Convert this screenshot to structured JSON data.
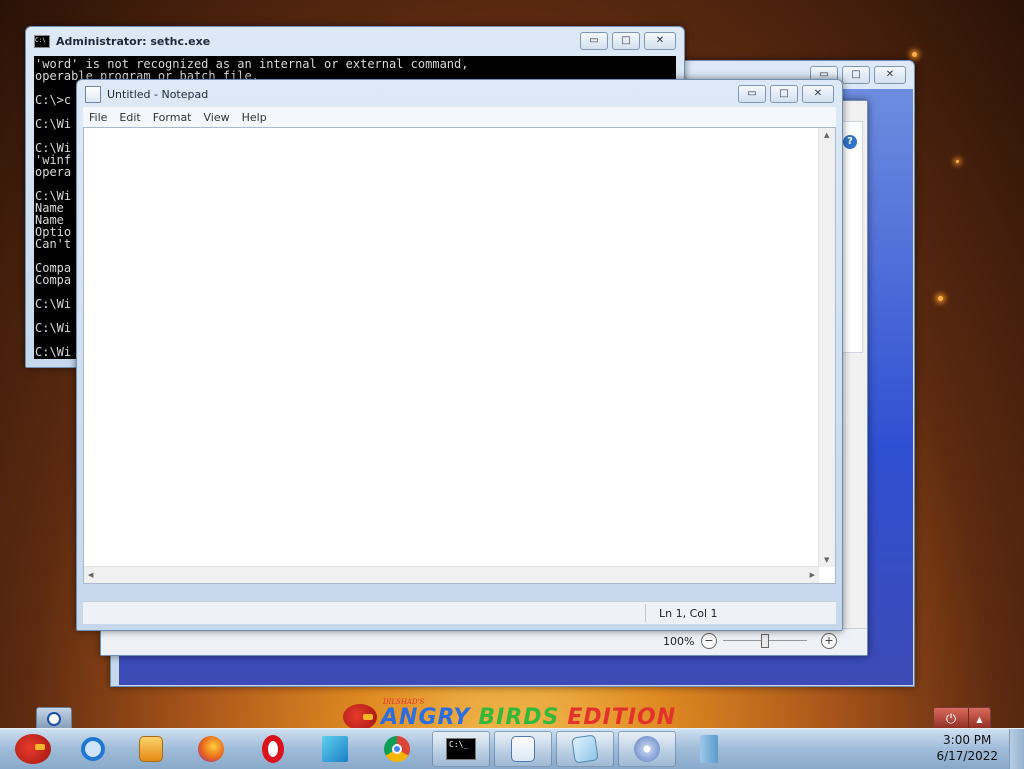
{
  "cmd": {
    "title": "Administrator: sethc.exe",
    "icon_label": "C:\\",
    "lines": [
      "'word' is not recognized as an internal or external command,",
      "operable program or batch file.",
      "",
      "C:\\>c",
      "",
      "C:\\Wi",
      "",
      "C:\\Wi",
      "'winf",
      "opera",
      "",
      "C:\\Wi",
      "Name",
      "Name",
      "Optio",
      "Can't",
      "",
      "Compa",
      "Compa",
      "",
      "C:\\Wi",
      "",
      "C:\\Wi",
      "",
      "C:\\Wi"
    ]
  },
  "image_window": {
    "zoom": "100%",
    "zoom_out": "−",
    "zoom_in": "+",
    "help": "?"
  },
  "notepad": {
    "title": "Untitled - Notepad",
    "menu": [
      "File",
      "Edit",
      "Format",
      "View",
      "Help"
    ],
    "content": "",
    "status_position": "Ln 1, Col 1"
  },
  "window_controls": {
    "minimize": "▭",
    "maximize": "□",
    "close": "✕"
  },
  "desktop": {
    "logo_small": "DILSHAD'S",
    "logo_word1": "ANGRY",
    "logo_word2": "BIRDS",
    "logo_word3": "EDITION",
    "power_glyph": "⏻",
    "power_arrow": "▲"
  },
  "taskbar": {
    "time": "3:00 PM",
    "date": "6/17/2022",
    "cmd_glyph": "C:\\_",
    "colors": {
      "firefox": "#e8631c",
      "opera": "#d9121c",
      "chrome_red": "#db4437",
      "chrome_green": "#0f9d58",
      "chrome_yellow": "#f4b400",
      "chrome_blue": "#4285f4",
      "ie": "#1e78d2"
    }
  }
}
